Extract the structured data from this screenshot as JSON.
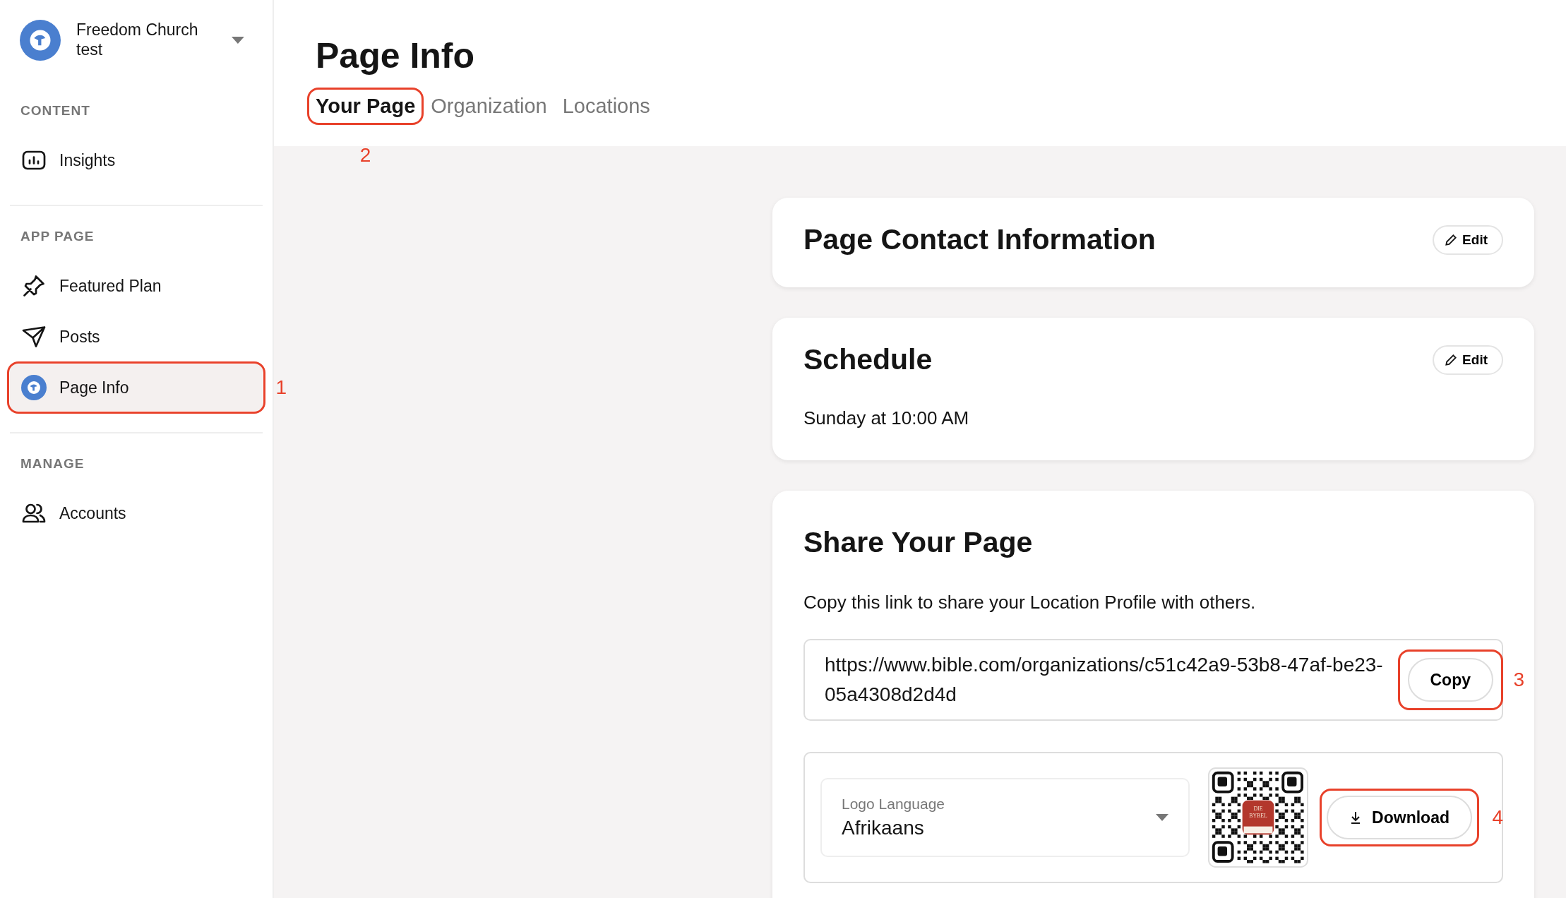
{
  "org": {
    "name": "Freedom Church test"
  },
  "sidebar": {
    "sections": [
      {
        "label": "CONTENT",
        "items": [
          {
            "label": "Insights",
            "kind": "chart",
            "selected": false
          }
        ]
      },
      {
        "label": "APP PAGE",
        "items": [
          {
            "label": "Featured Plan",
            "kind": "pin",
            "selected": false
          },
          {
            "label": "Posts",
            "kind": "send",
            "selected": false
          },
          {
            "label": "Page Info",
            "kind": "avatar",
            "selected": true,
            "annotation": "1"
          }
        ]
      },
      {
        "label": "MANAGE",
        "items": [
          {
            "label": "Accounts",
            "kind": "people",
            "selected": false
          }
        ]
      }
    ]
  },
  "page": {
    "title": "Page Info"
  },
  "tabs": [
    {
      "label": "Your Page",
      "selected": true,
      "annotation": "2"
    },
    {
      "label": "Organization",
      "selected": false
    },
    {
      "label": "Locations",
      "selected": false
    }
  ],
  "cards": [
    {
      "kind": "edit",
      "title": "Page Contact Information",
      "edit_label": "Edit"
    },
    {
      "kind": "edit",
      "title": "Schedule",
      "edit_label": "Edit",
      "body": "Sunday at 10:00 AM"
    },
    {
      "kind": "share",
      "title": "Share Your Page",
      "body": "Copy this link to share your Location Profile with others.",
      "link": "https://www.bible.com/organizations/c51c42a9-53b8-47af-be23-05a4308d2d4d",
      "copy_label": "Copy",
      "copy_annotation": "3",
      "select": {
        "label": "Logo Language",
        "value": "Afrikaans"
      },
      "qr_logo_text": [
        "DIE",
        "BYBEL"
      ],
      "download_label": "Download",
      "download_annotation": "4"
    }
  ]
}
